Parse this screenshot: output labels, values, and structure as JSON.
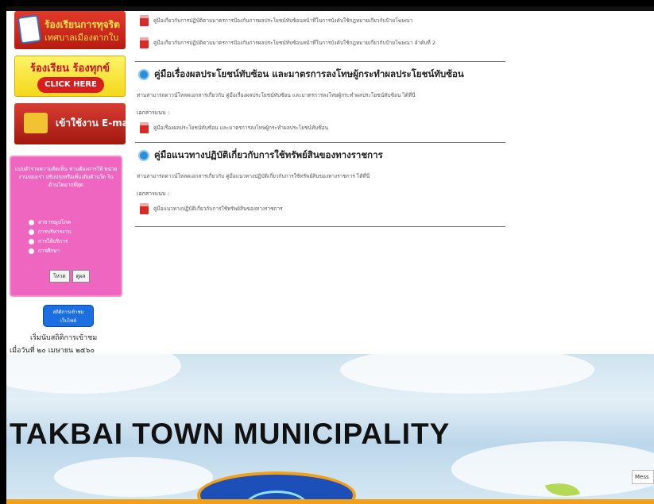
{
  "sidebar": {
    "complaint_banner": {
      "line1": "ร้องเรียนการทุจริต",
      "line2": "เทศบาลเมืองตากใบ"
    },
    "grievance_banner": {
      "title": "ร้องเรียน ร้องทุกข์",
      "button": "CLICK HERE"
    },
    "email_banner": {
      "label": "เข้าใช้งาน E-mail"
    },
    "poll": {
      "title": "แบบสำรวจความคิดเห็น ท่านต้องการให้ หน่วยงานของเรา ปรับปรุงหรือเพิ่มเติมด้านใด ในด้านใดมากที่สุด",
      "options": [
        "สาธารณูปโภค",
        "การบริหารงาน",
        "การให้บริการ",
        "การศึกษา"
      ],
      "vote_button": "โหวต",
      "results_button": "ดูผล"
    },
    "stats_button": {
      "line1": "สถิติการเข้าชม",
      "line2": "เว็บไซต์"
    },
    "stats_text1": "เริ่มนับสถิติการเข้าชม",
    "stats_text2": "เมื่อวันที่ ๒๐ เมษายน ๒๕๖๐"
  },
  "main": {
    "top_docs": [
      "คู่มือเกี่ยวกับการปฏิบัติตามมาตรการป้องกันการผลประโยชน์ทับซ้อนหน้าที่ในการบังคับใช้กฎหมายเกี่ยวกับป้ายโฆษณา",
      "คู่มือเกี่ยวกับการปฏิบัติตามมาตรการป้องกันการผลประโยชน์ทับซ้อนหน้าที่ในการบังคับใช้กฎหมายเกี่ยวกับป้ายโฆษณา ลำดับที่ 2"
    ],
    "sections": [
      {
        "title": "คู่มือเรื่องผลประโยชน์ทับซ้อน และมาตรการลงโทษผู้กระทำผลประโยชน์ทับซ้อน",
        "desc": "ท่านสามารถดาวน์โหลดเอกสารเกี่ยวกับ คู่มือเรื่องผลประโยชน์ทับซ้อน และมาตรการลงโทษผู้กระทำผลประโยชน์ทับซ้อน ได้ที่นี่",
        "label": "เอกสารแนบ :",
        "doc": "คู่มือเรื่องผลประโยชน์ทับซ้อน และมาตรการลงโทษผู้กระทำผลประโยชน์ทับซ้อน"
      },
      {
        "title": "คู่มือแนวทางปฏิบัติเกี่ยวกับการใช้ทรัพย์สินของทางราชการ",
        "desc": "ท่านสามารถดาวน์โหลดเอกสารเกี่ยวกับ คู่มือแนวทางปฏิบัติเกี่ยวกับการใช้ทรัพย์สินของทางราชการ ได้ที่นี่",
        "label": "เอกสารแนบ :",
        "doc": "คู่มือแนวทางปฏิบัติเกี่ยวกับการใช้ทรัพย์สินของทางราชการ"
      }
    ]
  },
  "footer": {
    "banner_title": "TAKBAI  TOWN  MUNICIPALITY",
    "messenger_tab": "Mess"
  },
  "icons": [
    "envelope-icon",
    "pdf-icon",
    "section-bullet-icon",
    "email-icon"
  ],
  "colors": {
    "section_bullet": "#2a8fd8",
    "poll_bg": "#ef66c0",
    "pdf": "#d92a2a",
    "banner_red": "#d83d33"
  }
}
